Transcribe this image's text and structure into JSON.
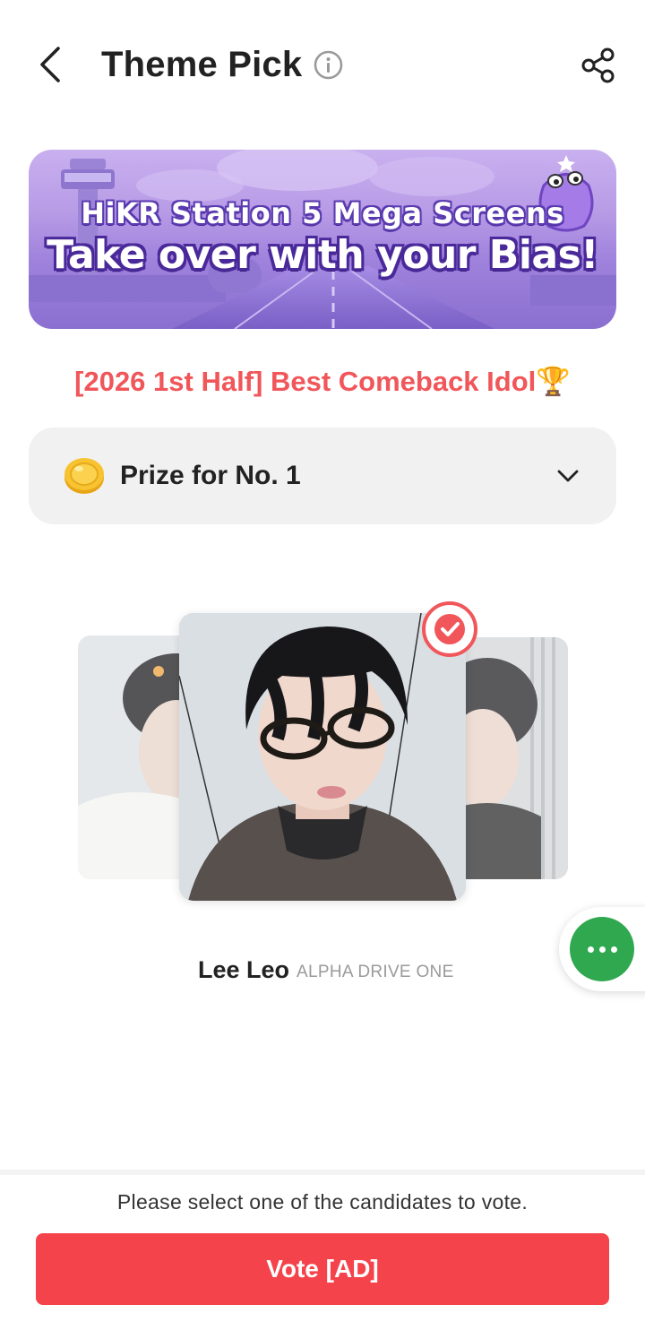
{
  "header": {
    "title": "Theme Pick",
    "back_icon": "chevron-left-icon",
    "info_icon": "info-icon",
    "share_icon": "share-icon"
  },
  "banner": {
    "line1": "HiKR Station 5 Mega Screens",
    "line2": "Take over with your Bias!"
  },
  "subtitle": "[2026 1st Half] Best Comeback Idol🏆",
  "prize": {
    "label": "Prize for No. 1",
    "icon": "coin-icon",
    "expand_icon": "chevron-down-icon"
  },
  "candidate": {
    "name": "Lee Leo",
    "group": "ALPHA DRIVE ONE",
    "selected": true
  },
  "footer": {
    "hint": "Please select one of the candidates to vote.",
    "vote_label": "Vote [AD]"
  },
  "colors": {
    "accent": "#f4434a",
    "subtitle": "#f0565a",
    "more_button": "#2fa84f",
    "banner": "#a98be0"
  }
}
